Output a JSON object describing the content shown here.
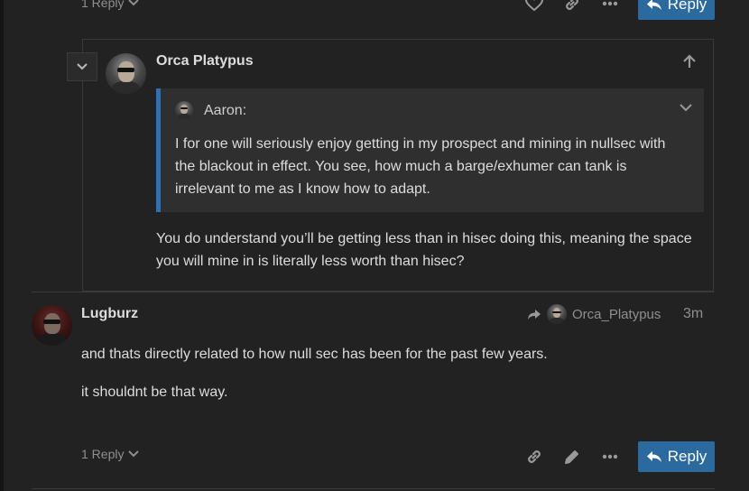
{
  "top_actions": {
    "replies_label": "1 Reply",
    "reply_button": "Reply",
    "icons": [
      "heart-icon",
      "link-icon",
      "more-icon",
      "reply-icon"
    ]
  },
  "embedded_post": {
    "username": "Orca Platypus",
    "quote": {
      "author": "Aaron:",
      "text": "I for one will seriously enjoy getting in my prospect and mining in nullsec with the blackout in effect. You see, how much a barge/exhumer can tank is irrelevant to me as I know how to adapt."
    },
    "body": "You do understand you’ll be getting less than in hisec doing this, meaning the space you will mine in is literally less worth than hisec?"
  },
  "post": {
    "username": "Lugburz",
    "reply_to_user": "Orca_Platypus",
    "time": "3m",
    "paragraphs": [
      "and thats directly related to how null sec has been for the past few years.",
      "it shouldnt be that way."
    ],
    "replies_label": "1 Reply",
    "reply_button": "Reply"
  },
  "colors": {
    "background": "#222222",
    "accent": "#2a6a9e",
    "quote_border": "#2a72b5",
    "muted": "#8f8f8f"
  }
}
